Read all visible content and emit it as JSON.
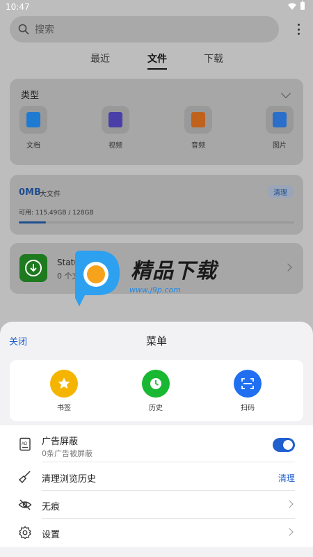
{
  "status_bar": {
    "time": "10:47"
  },
  "search": {
    "placeholder": "搜索"
  },
  "top_tabs": [
    {
      "label": "最近"
    },
    {
      "label": "文件"
    },
    {
      "label": "下载"
    }
  ],
  "type_card": {
    "title": "类型",
    "categories": [
      {
        "label": "文档",
        "icon": "document-icon",
        "color": "#1e7bd1"
      },
      {
        "label": "视频",
        "icon": "video-icon",
        "color": "#4a3ea8"
      },
      {
        "label": "音频",
        "icon": "audio-icon",
        "color": "#c0621c"
      },
      {
        "label": "图片",
        "icon": "image-icon",
        "color": "#2a6fc9"
      }
    ]
  },
  "storage_card": {
    "size": "0MB",
    "big_files_label": "大文件",
    "clean_label": "清理",
    "available": "可用: 115.49GB / 128GB",
    "used_fraction": 0.0977
  },
  "app_card": {
    "name": "Status Saver",
    "subtitle": "0 个文件"
  },
  "watermark": {
    "text": "精品下载",
    "url": "www.j9p.com"
  },
  "sheet": {
    "close_label": "关闭",
    "title": "菜单",
    "quick_actions": [
      {
        "label": "书签",
        "icon": "star-icon",
        "color": "#f5b400"
      },
      {
        "label": "历史",
        "icon": "clock-icon",
        "color": "#18b832"
      },
      {
        "label": "扫码",
        "icon": "scan-icon",
        "color": "#1f6ff0"
      }
    ],
    "ad_block": {
      "label": "广告屏蔽",
      "subtitle": "0条广告被屏蔽",
      "enabled": true
    },
    "clear_history": {
      "label": "清理浏览历史",
      "action": "清理"
    },
    "incognito": {
      "label": "无痕"
    },
    "settings": {
      "label": "设置"
    }
  }
}
